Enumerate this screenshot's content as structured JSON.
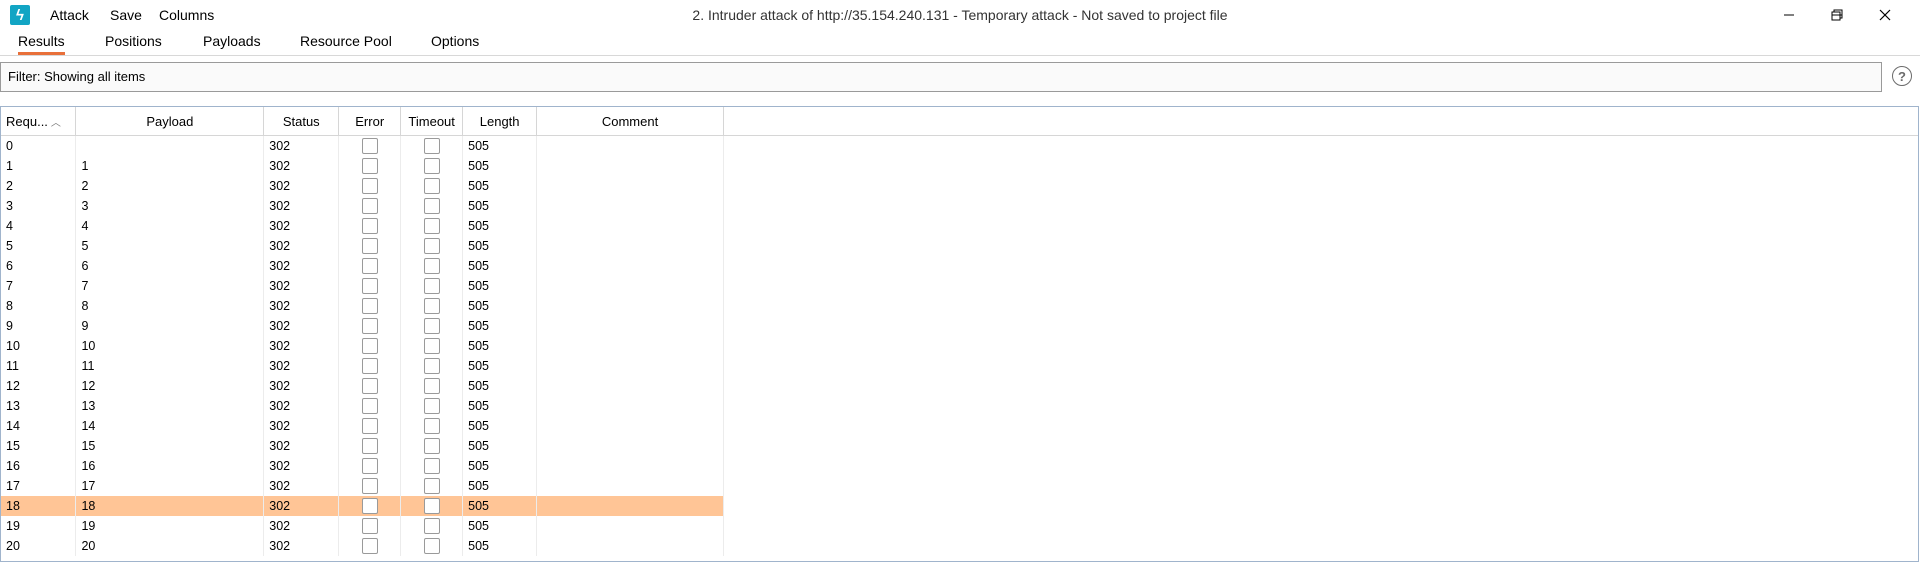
{
  "app": {
    "icon_glyph": "ϟ",
    "menu": [
      "Attack",
      "Save",
      "Columns"
    ],
    "window_title": "2. Intruder attack of http://35.154.240.131 - Temporary attack - Not saved to project file"
  },
  "tabs": [
    {
      "label": "Results",
      "active": true
    },
    {
      "label": "Positions",
      "active": false
    },
    {
      "label": "Payloads",
      "active": false
    },
    {
      "label": "Resource Pool",
      "active": false
    },
    {
      "label": "Options",
      "active": false
    }
  ],
  "filter": {
    "text": "Filter: Showing all items"
  },
  "help_icon": "?",
  "table": {
    "columns": [
      "Requ...",
      "Payload",
      "Status",
      "Error",
      "Timeout",
      "Length",
      "Comment"
    ],
    "sorted_column": "Requ...",
    "selected_row": 18,
    "rows": [
      {
        "request": "0",
        "payload": "",
        "status": "302",
        "length": "505"
      },
      {
        "request": "1",
        "payload": "1",
        "status": "302",
        "length": "505"
      },
      {
        "request": "2",
        "payload": "2",
        "status": "302",
        "length": "505"
      },
      {
        "request": "3",
        "payload": "3",
        "status": "302",
        "length": "505"
      },
      {
        "request": "4",
        "payload": "4",
        "status": "302",
        "length": "505"
      },
      {
        "request": "5",
        "payload": "5",
        "status": "302",
        "length": "505"
      },
      {
        "request": "6",
        "payload": "6",
        "status": "302",
        "length": "505"
      },
      {
        "request": "7",
        "payload": "7",
        "status": "302",
        "length": "505"
      },
      {
        "request": "8",
        "payload": "8",
        "status": "302",
        "length": "505"
      },
      {
        "request": "9",
        "payload": "9",
        "status": "302",
        "length": "505"
      },
      {
        "request": "10",
        "payload": "10",
        "status": "302",
        "length": "505"
      },
      {
        "request": "11",
        "payload": "11",
        "status": "302",
        "length": "505"
      },
      {
        "request": "12",
        "payload": "12",
        "status": "302",
        "length": "505"
      },
      {
        "request": "13",
        "payload": "13",
        "status": "302",
        "length": "505"
      },
      {
        "request": "14",
        "payload": "14",
        "status": "302",
        "length": "505"
      },
      {
        "request": "15",
        "payload": "15",
        "status": "302",
        "length": "505"
      },
      {
        "request": "16",
        "payload": "16",
        "status": "302",
        "length": "505"
      },
      {
        "request": "17",
        "payload": "17",
        "status": "302",
        "length": "505"
      },
      {
        "request": "18",
        "payload": "18",
        "status": "302",
        "length": "505"
      },
      {
        "request": "19",
        "payload": "19",
        "status": "302",
        "length": "505"
      },
      {
        "request": "20",
        "payload": "20",
        "status": "302",
        "length": "505"
      }
    ]
  },
  "colors": {
    "accent": "#e8703a",
    "selected_row": "#ffc596",
    "app_icon": "#12a5c4"
  }
}
